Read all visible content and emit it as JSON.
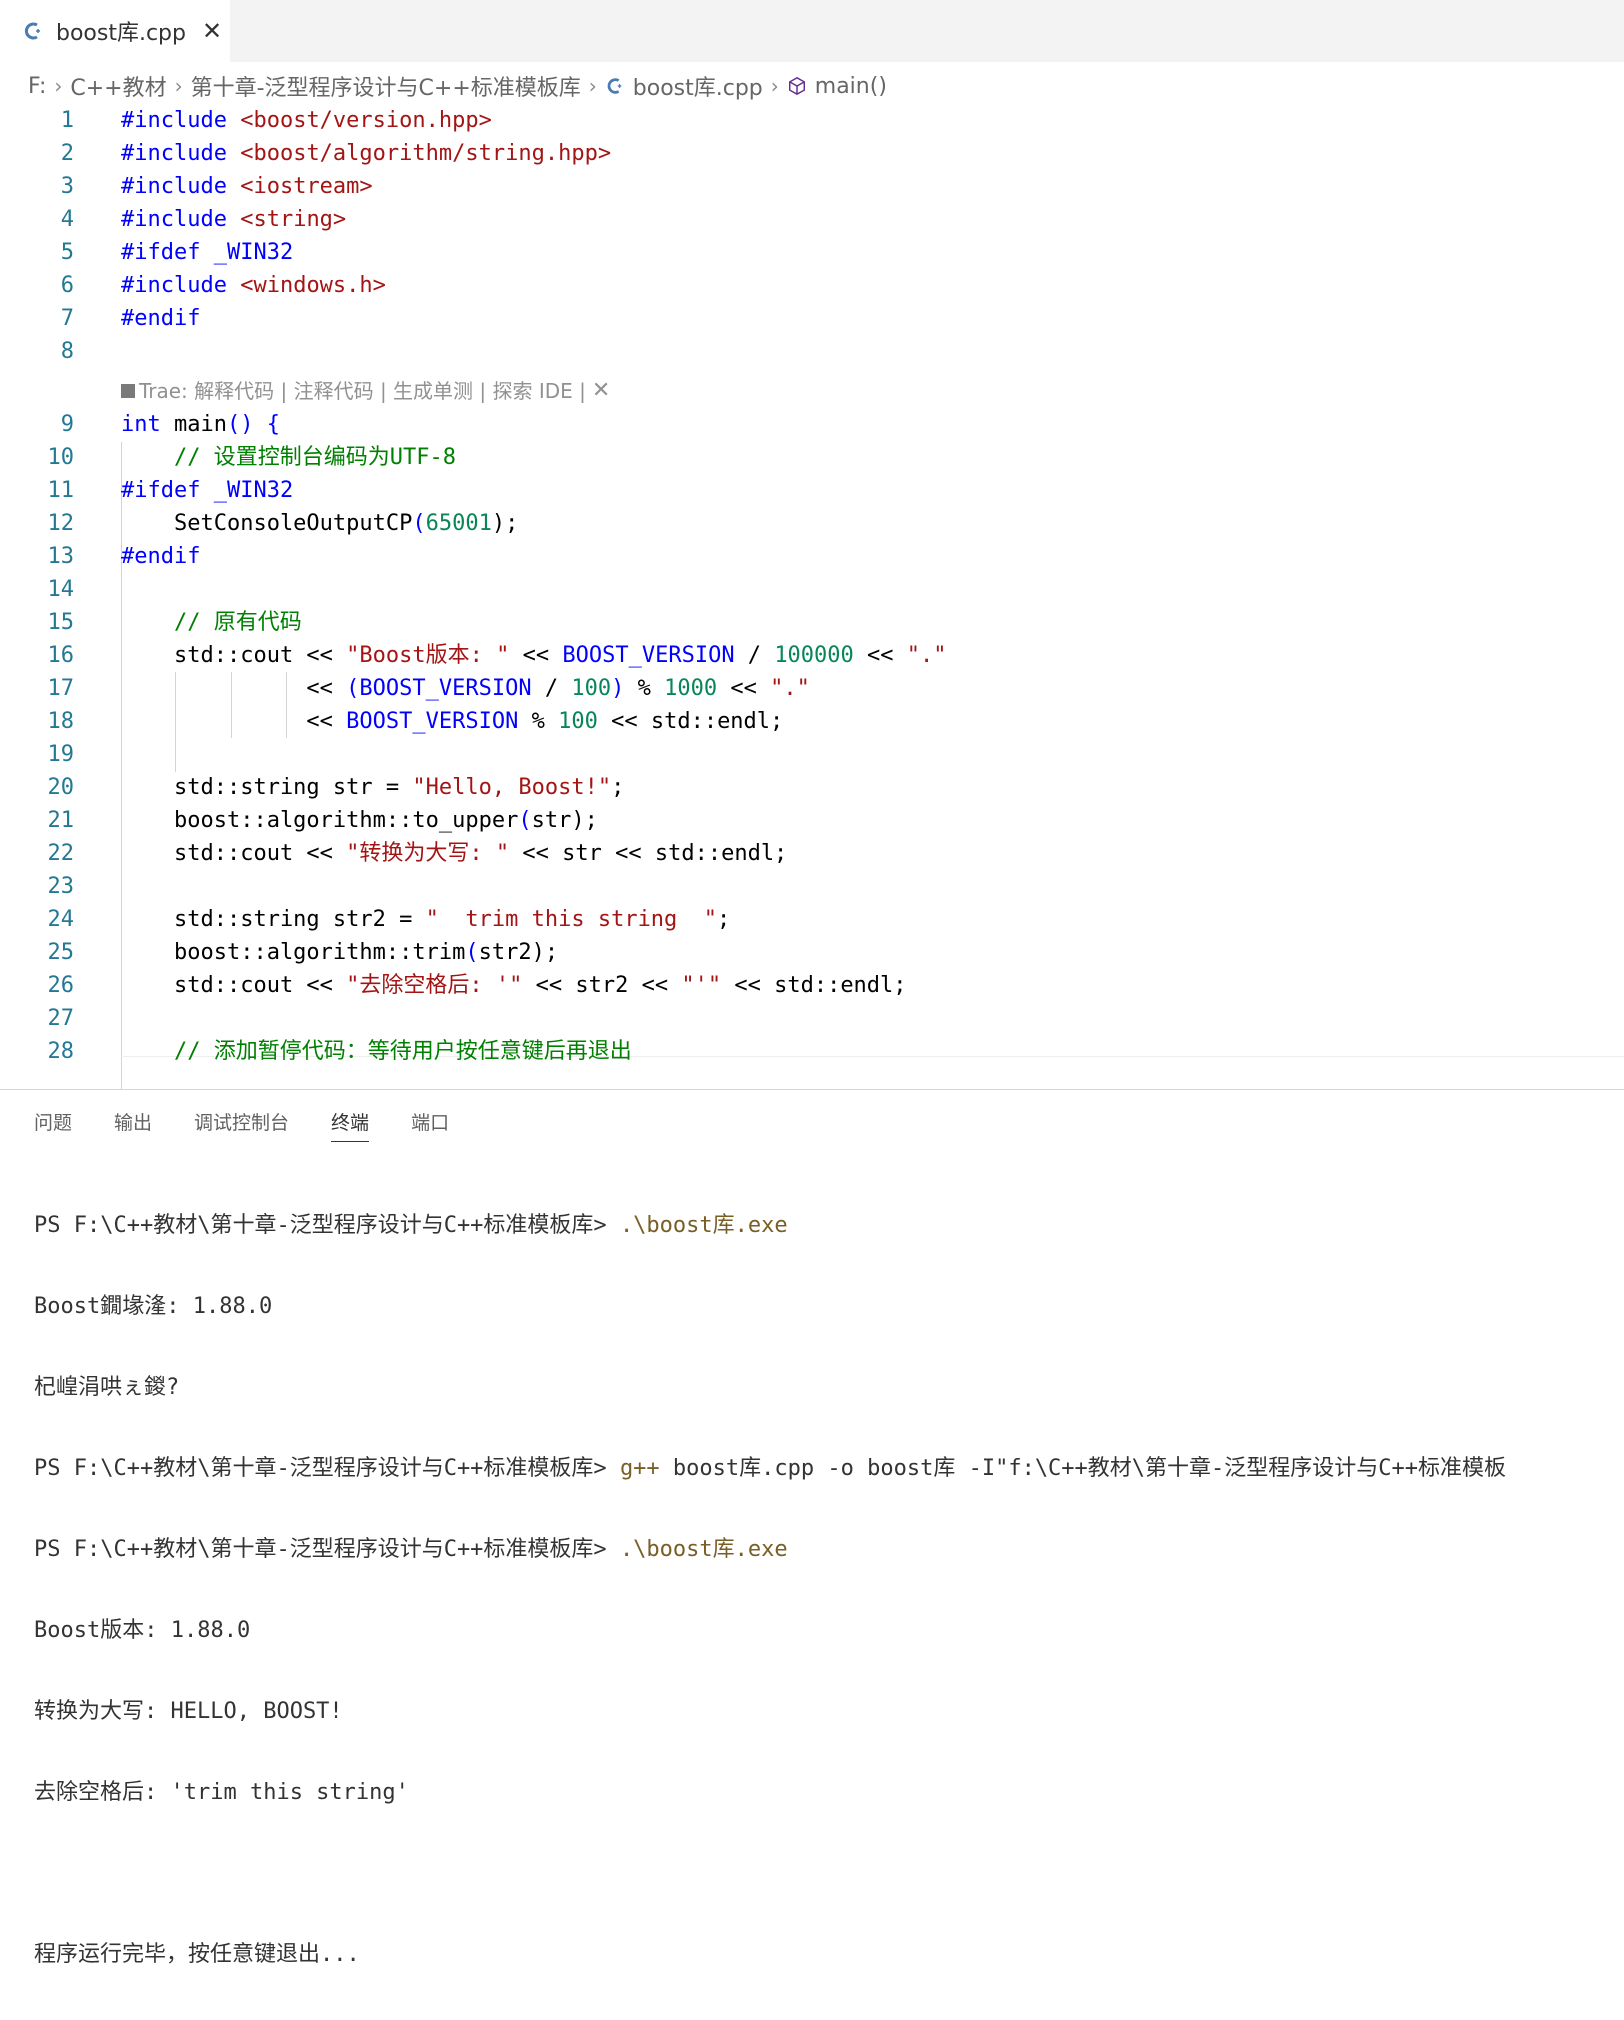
{
  "tab": {
    "filename": "boost库.cpp",
    "close": "✕"
  },
  "breadcrumb": {
    "drive": "F:",
    "folder1": "C++教材",
    "folder2": "第十章-泛型程序设计与C++标准模板库",
    "file": "boost库.cpp",
    "symbol": "main()"
  },
  "codelens": {
    "text": "Trae: 解释代码 | 注释代码 | 生成单测 | 探索 IDE |"
  },
  "editor": {
    "line_numbers": [
      "1",
      "2",
      "3",
      "4",
      "5",
      "6",
      "7",
      "8",
      "9",
      "10",
      "11",
      "12",
      "13",
      "14",
      "15",
      "16",
      "17",
      "18",
      "19",
      "20",
      "21",
      "22",
      "23",
      "24",
      "25",
      "26",
      "27",
      "28"
    ],
    "l1": {
      "a": "#include",
      "b": " <boost/version.hpp>"
    },
    "l2": {
      "a": "#include",
      "b": " <boost/algorithm/string.hpp>"
    },
    "l3": {
      "a": "#include",
      "b": " <iostream>"
    },
    "l4": {
      "a": "#include",
      "b": " <string>"
    },
    "l5": {
      "a": "#ifdef",
      "b": " _WIN32"
    },
    "l6": {
      "a": "#include",
      "b": " <windows.h>"
    },
    "l7": {
      "a": "#endif"
    },
    "l9": {
      "a": "int",
      "b": " main",
      "c": "() {"
    },
    "l10": {
      "a": "    // 设置控制台编码为UTF-8"
    },
    "l11": {
      "a": "#ifdef",
      "b": " _WIN32"
    },
    "l12": {
      "a": "    SetConsoleOutputCP",
      "b": "(",
      "c": "65001",
      "d": ");"
    },
    "l13": {
      "a": "#endif"
    },
    "l15": {
      "a": "    // 原有代码"
    },
    "l16": {
      "a": "    std::cout << ",
      "b": "\"Boost版本: \"",
      "c": " << ",
      "d": "BOOST_VERSION",
      "e": " / ",
      "f": "100000",
      "g": " << ",
      "h": "\".\""
    },
    "l17": {
      "a": "              << ",
      "b": "(",
      "c": "BOOST_VERSION",
      "d": " / ",
      "e": "100",
      "f": ")",
      "g": " % ",
      "h": "1000",
      "i": " << ",
      "j": "\".\""
    },
    "l18": {
      "a": "              << ",
      "b": "BOOST_VERSION",
      "c": " % ",
      "d": "100",
      "e": " << std::endl;"
    },
    "l20": {
      "a": "    std::string str = ",
      "b": "\"Hello, Boost!\"",
      "c": ";"
    },
    "l21": {
      "a": "    boost::algorithm::to_upper",
      "b": "(",
      "c": "str",
      "d": ");"
    },
    "l22": {
      "a": "    std::cout << ",
      "b": "\"转换为大写: \"",
      "c": " << str << std::endl;"
    },
    "l24": {
      "a": "    std::string str2 = ",
      "b": "\"  trim this string  \"",
      "c": ";"
    },
    "l25": {
      "a": "    boost::algorithm::trim",
      "b": "(",
      "c": "str2",
      "d": ");"
    },
    "l26": {
      "a": "    std::cout << ",
      "b": "\"去除空格后: '\"",
      "c": " << str2 << ",
      "d": "\"'\"",
      "e": " << std::endl;"
    },
    "l28": {
      "a": "    // 添加暂停代码：等待用户按任意键后再退出"
    }
  },
  "panel": {
    "tabs": [
      "问题",
      "输出",
      "调试控制台",
      "终端",
      "端口"
    ],
    "active_tab": "终端"
  },
  "terminal": {
    "t1_prompt": "PS F:\\C++教材\\第十章-泛型程序设计与C++标准模板库> ",
    "t1_cmd": ".\\boost库.exe",
    "t2": "Boost鐗堟湰: 1.88.0",
    "t3": "杞崲涓哄ぇ鍐?",
    "t4_prompt": "PS F:\\C++教材\\第十章-泛型程序设计与C++标准模板库> ",
    "t4_cmd": "g++",
    "t4_rest": " boost库.cpp -o boost库 -I\"f:\\C++教材\\第十章-泛型程序设计与C++标准模板",
    "t5_prompt": "PS F:\\C++教材\\第十章-泛型程序设计与C++标准模板库> ",
    "t5_cmd": ".\\boost库.exe",
    "t6": "Boost版本: 1.88.0",
    "t7": "转换为大写: HELLO, BOOST!",
    "t8": "去除空格后: 'trim this string'",
    "t9": "",
    "t10": "程序运行完毕，按任意键退出..."
  },
  "colors": {
    "keyword": "#0000ff",
    "string": "#a31515",
    "comment": "#008000",
    "number": "#098658",
    "line_number": "#237893"
  }
}
